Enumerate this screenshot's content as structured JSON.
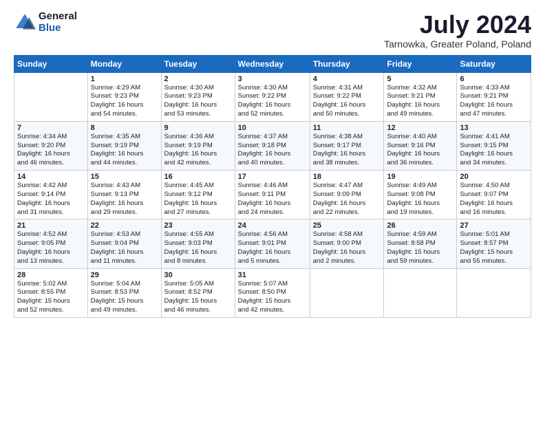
{
  "logo": {
    "general": "General",
    "blue": "Blue"
  },
  "header": {
    "month": "July 2024",
    "location": "Tarnowka, Greater Poland, Poland"
  },
  "weekdays": [
    "Sunday",
    "Monday",
    "Tuesday",
    "Wednesday",
    "Thursday",
    "Friday",
    "Saturday"
  ],
  "weeks": [
    [
      {
        "day": "",
        "info": ""
      },
      {
        "day": "1",
        "info": "Sunrise: 4:29 AM\nSunset: 9:23 PM\nDaylight: 16 hours\nand 54 minutes."
      },
      {
        "day": "2",
        "info": "Sunrise: 4:30 AM\nSunset: 9:23 PM\nDaylight: 16 hours\nand 53 minutes."
      },
      {
        "day": "3",
        "info": "Sunrise: 4:30 AM\nSunset: 9:22 PM\nDaylight: 16 hours\nand 52 minutes."
      },
      {
        "day": "4",
        "info": "Sunrise: 4:31 AM\nSunset: 9:22 PM\nDaylight: 16 hours\nand 50 minutes."
      },
      {
        "day": "5",
        "info": "Sunrise: 4:32 AM\nSunset: 9:21 PM\nDaylight: 16 hours\nand 49 minutes."
      },
      {
        "day": "6",
        "info": "Sunrise: 4:33 AM\nSunset: 9:21 PM\nDaylight: 16 hours\nand 47 minutes."
      }
    ],
    [
      {
        "day": "7",
        "info": "Sunrise: 4:34 AM\nSunset: 9:20 PM\nDaylight: 16 hours\nand 46 minutes."
      },
      {
        "day": "8",
        "info": "Sunrise: 4:35 AM\nSunset: 9:19 PM\nDaylight: 16 hours\nand 44 minutes."
      },
      {
        "day": "9",
        "info": "Sunrise: 4:36 AM\nSunset: 9:19 PM\nDaylight: 16 hours\nand 42 minutes."
      },
      {
        "day": "10",
        "info": "Sunrise: 4:37 AM\nSunset: 9:18 PM\nDaylight: 16 hours\nand 40 minutes."
      },
      {
        "day": "11",
        "info": "Sunrise: 4:38 AM\nSunset: 9:17 PM\nDaylight: 16 hours\nand 38 minutes."
      },
      {
        "day": "12",
        "info": "Sunrise: 4:40 AM\nSunset: 9:16 PM\nDaylight: 16 hours\nand 36 minutes."
      },
      {
        "day": "13",
        "info": "Sunrise: 4:41 AM\nSunset: 9:15 PM\nDaylight: 16 hours\nand 34 minutes."
      }
    ],
    [
      {
        "day": "14",
        "info": "Sunrise: 4:42 AM\nSunset: 9:14 PM\nDaylight: 16 hours\nand 31 minutes."
      },
      {
        "day": "15",
        "info": "Sunrise: 4:43 AM\nSunset: 9:13 PM\nDaylight: 16 hours\nand 29 minutes."
      },
      {
        "day": "16",
        "info": "Sunrise: 4:45 AM\nSunset: 9:12 PM\nDaylight: 16 hours\nand 27 minutes."
      },
      {
        "day": "17",
        "info": "Sunrise: 4:46 AM\nSunset: 9:11 PM\nDaylight: 16 hours\nand 24 minutes."
      },
      {
        "day": "18",
        "info": "Sunrise: 4:47 AM\nSunset: 9:09 PM\nDaylight: 16 hours\nand 22 minutes."
      },
      {
        "day": "19",
        "info": "Sunrise: 4:49 AM\nSunset: 9:08 PM\nDaylight: 16 hours\nand 19 minutes."
      },
      {
        "day": "20",
        "info": "Sunrise: 4:50 AM\nSunset: 9:07 PM\nDaylight: 16 hours\nand 16 minutes."
      }
    ],
    [
      {
        "day": "21",
        "info": "Sunrise: 4:52 AM\nSunset: 9:05 PM\nDaylight: 16 hours\nand 13 minutes."
      },
      {
        "day": "22",
        "info": "Sunrise: 4:53 AM\nSunset: 9:04 PM\nDaylight: 16 hours\nand 11 minutes."
      },
      {
        "day": "23",
        "info": "Sunrise: 4:55 AM\nSunset: 9:03 PM\nDaylight: 16 hours\nand 8 minutes."
      },
      {
        "day": "24",
        "info": "Sunrise: 4:56 AM\nSunset: 9:01 PM\nDaylight: 16 hours\nand 5 minutes."
      },
      {
        "day": "25",
        "info": "Sunrise: 4:58 AM\nSunset: 9:00 PM\nDaylight: 16 hours\nand 2 minutes."
      },
      {
        "day": "26",
        "info": "Sunrise: 4:59 AM\nSunset: 8:58 PM\nDaylight: 15 hours\nand 59 minutes."
      },
      {
        "day": "27",
        "info": "Sunrise: 5:01 AM\nSunset: 8:57 PM\nDaylight: 15 hours\nand 55 minutes."
      }
    ],
    [
      {
        "day": "28",
        "info": "Sunrise: 5:02 AM\nSunset: 8:55 PM\nDaylight: 15 hours\nand 52 minutes."
      },
      {
        "day": "29",
        "info": "Sunrise: 5:04 AM\nSunset: 8:53 PM\nDaylight: 15 hours\nand 49 minutes."
      },
      {
        "day": "30",
        "info": "Sunrise: 5:05 AM\nSunset: 8:52 PM\nDaylight: 15 hours\nand 46 minutes."
      },
      {
        "day": "31",
        "info": "Sunrise: 5:07 AM\nSunset: 8:50 PM\nDaylight: 15 hours\nand 42 minutes."
      },
      {
        "day": "",
        "info": ""
      },
      {
        "day": "",
        "info": ""
      },
      {
        "day": "",
        "info": ""
      }
    ]
  ]
}
